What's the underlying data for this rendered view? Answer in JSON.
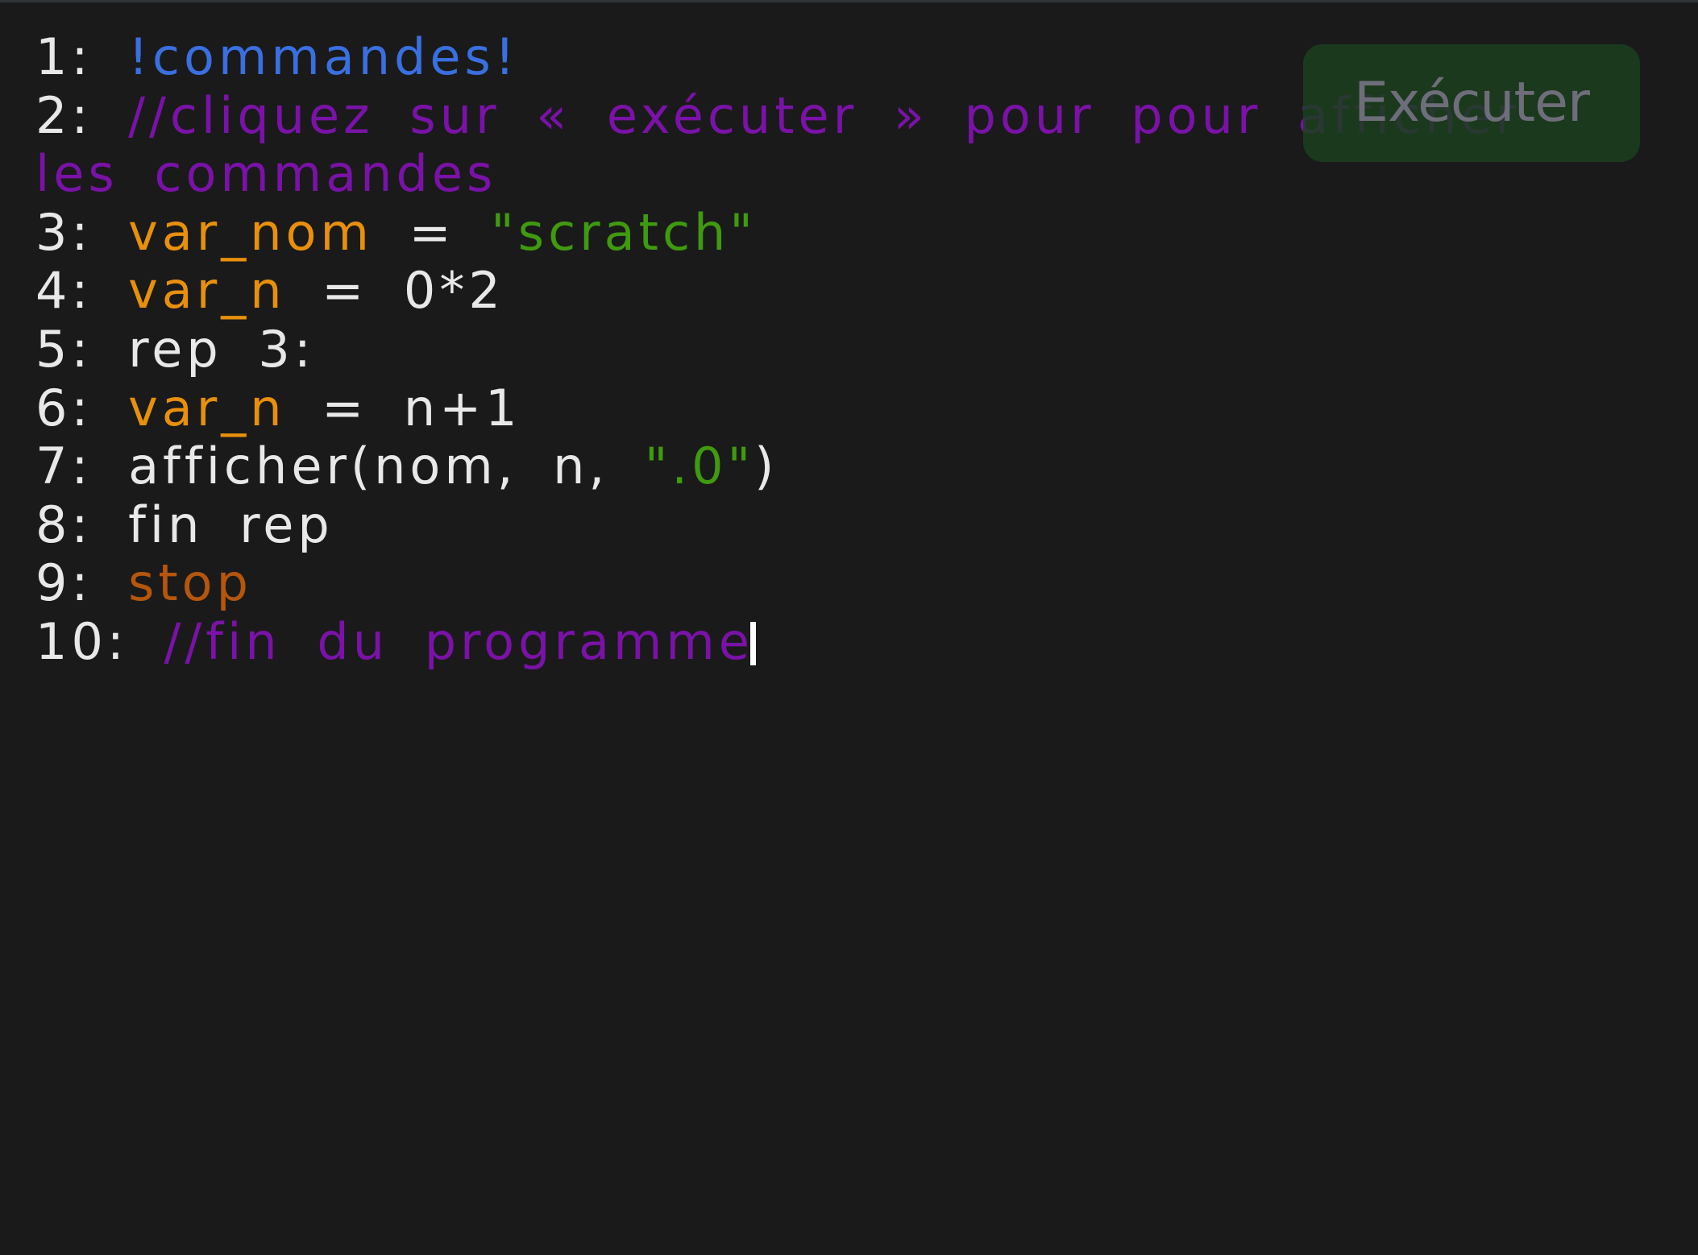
{
  "editor": {
    "run_button_label": "Exécuter",
    "colors": {
      "background": "#1a1a1a",
      "default_text": "#e8e8e8",
      "directive": "#3a6fe0",
      "comment": "#7a12a8",
      "variable": "#e8900c",
      "string": "#3f9a10",
      "stop_keyword": "#b5560c",
      "run_button_bg": "#1c401e"
    },
    "lines": [
      {
        "num": "1:",
        "tokens": [
          {
            "text": "!commandes!",
            "kind": "blue"
          }
        ]
      },
      {
        "num": "2:",
        "tokens": [
          {
            "text": "//cliquez sur « exécuter » pour pour afficher les commandes",
            "kind": "purple"
          }
        ]
      },
      {
        "num": "3:",
        "tokens": [
          {
            "text": "var_nom",
            "kind": "orange"
          },
          {
            "text": " = ",
            "kind": "white"
          },
          {
            "text": "\"scratch\"",
            "kind": "green"
          }
        ]
      },
      {
        "num": "4:",
        "tokens": [
          {
            "text": "var_n",
            "kind": "orange"
          },
          {
            "text": " = 0*2",
            "kind": "white"
          }
        ]
      },
      {
        "num": "5:",
        "tokens": [
          {
            "text": "rep 3:",
            "kind": "white"
          }
        ]
      },
      {
        "num": "6:",
        "tokens": [
          {
            "text": "var_n",
            "kind": "orange"
          },
          {
            "text": " = n+1",
            "kind": "white"
          }
        ]
      },
      {
        "num": "7:",
        "tokens": [
          {
            "text": "afficher(nom, n, ",
            "kind": "white"
          },
          {
            "text": "\".0\"",
            "kind": "green"
          },
          {
            "text": ")",
            "kind": "white"
          }
        ]
      },
      {
        "num": "8:",
        "tokens": [
          {
            "text": "fin rep",
            "kind": "white"
          }
        ]
      },
      {
        "num": "9:",
        "tokens": [
          {
            "text": "stop",
            "kind": "stop"
          }
        ]
      },
      {
        "num": "10:",
        "tokens": [
          {
            "text": "//fin du programme",
            "kind": "purple"
          }
        ]
      }
    ]
  }
}
